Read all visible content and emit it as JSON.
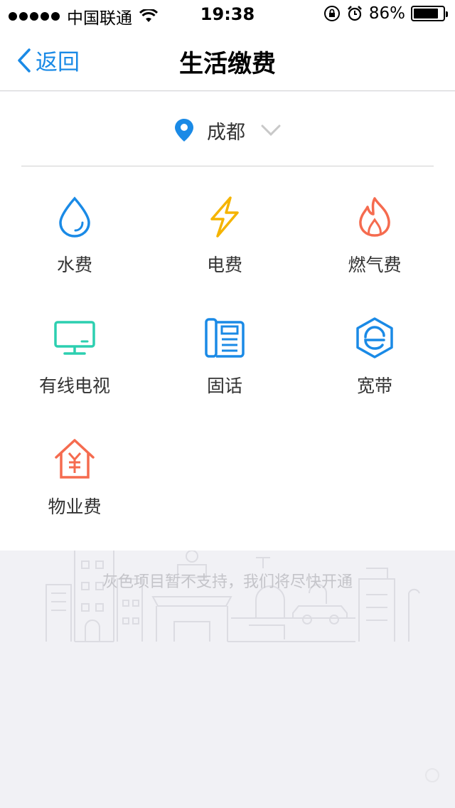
{
  "status_bar": {
    "carrier": "中国联通",
    "time": "19:38",
    "battery_percent": "86%",
    "battery_level": 0.86
  },
  "nav": {
    "back_label": "返回",
    "title": "生活缴费"
  },
  "city": {
    "name": "成都"
  },
  "services": [
    {
      "label": "水费",
      "icon": "water-drop-icon",
      "color": "#1a8ae6"
    },
    {
      "label": "电费",
      "icon": "lightning-icon",
      "color": "#f5b400"
    },
    {
      "label": "燃气费",
      "icon": "flame-icon",
      "color": "#f56b4f"
    },
    {
      "label": "有线电视",
      "icon": "tv-icon",
      "color": "#2ccfb0"
    },
    {
      "label": "固话",
      "icon": "telephone-icon",
      "color": "#1a8ae6"
    },
    {
      "label": "宽带",
      "icon": "broadband-icon",
      "color": "#1a8ae6"
    },
    {
      "label": "物业费",
      "icon": "property-house-icon",
      "color": "#f56b4f"
    }
  ],
  "notice": "灰色项目暂不支持，我们将尽快开通",
  "colors": {
    "accent": "#1a8ae6",
    "background": "#f1f1f5"
  }
}
